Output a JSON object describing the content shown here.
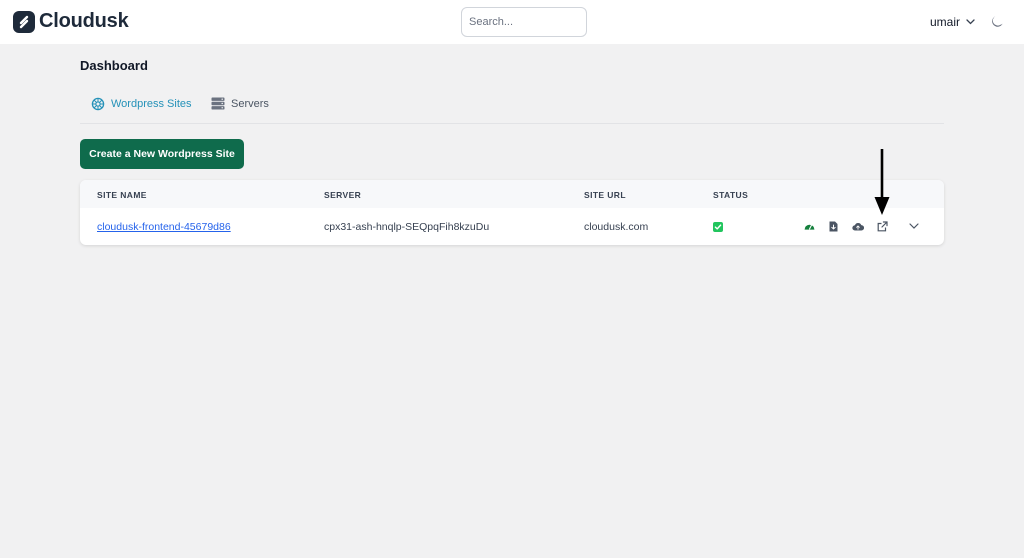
{
  "app": {
    "name": "Cloudusk"
  },
  "header": {
    "search_placeholder": "Search...",
    "user_name": "umair"
  },
  "page": {
    "title": "Dashboard"
  },
  "tabs": [
    {
      "label": "Wordpress Sites",
      "active": true
    },
    {
      "label": "Servers",
      "active": false
    }
  ],
  "actions": {
    "create_label": "Create a New Wordpress Site"
  },
  "table": {
    "columns": [
      "SITE NAME",
      "SERVER",
      "SITE URL",
      "STATUS"
    ],
    "rows": [
      {
        "site_name": "cloudusk-frontend-45679d86",
        "server": "cpx31-ash-hnqlp-SEQpqFih8kzuDu",
        "site_url": "cloudusk.com",
        "status": "active",
        "row_actions": [
          "speed-gauge-icon",
          "file-download-icon",
          "cloud-upload-icon",
          "external-link-icon",
          "chevron-down-icon"
        ]
      }
    ]
  },
  "colors": {
    "brand": "#1e2a3a",
    "accent": "#2491b8",
    "primary_button": "#0f6b4c",
    "link": "#2563eb",
    "status_ok": "#22c55e",
    "gauge": "#15803d"
  }
}
